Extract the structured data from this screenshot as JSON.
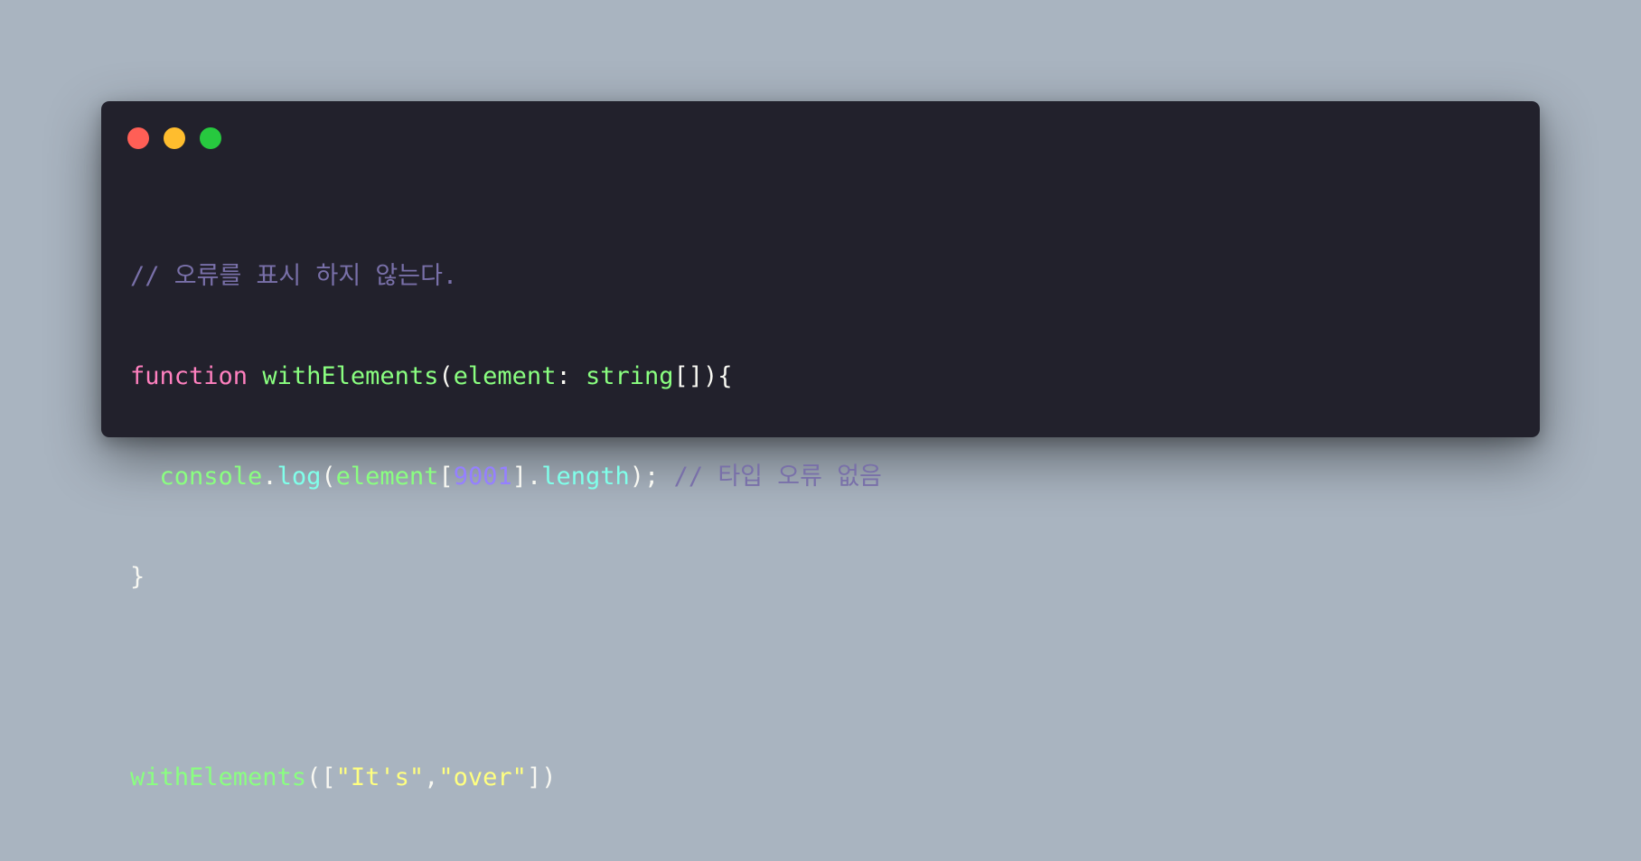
{
  "window": {
    "controls": {
      "close_color": "#ff5f56",
      "minimize_color": "#ffbd2e",
      "maximize_color": "#27c93f"
    }
  },
  "code": {
    "line1": {
      "comment": "// 오류를 표시 하지 않는다."
    },
    "line2": {
      "keyword": "function",
      "fn_name": "withElements",
      "open_paren": "(",
      "param": "element",
      "colon": ":",
      "type": "string",
      "type_suffix": "[]",
      "close": "){"
    },
    "line3": {
      "indent": "  ",
      "object": "console",
      "dot1": ".",
      "method": "log",
      "open_paren": "(",
      "ident": "element",
      "open_bracket": "[",
      "number": "9001",
      "close_bracket": "]",
      "dot2": ".",
      "prop": "length",
      "end": ");",
      "comment": "// 타입 오류 없음"
    },
    "line4": {
      "close_brace": "}"
    },
    "line6": {
      "fn_name": "withElements",
      "open": "([",
      "str1": "\"It's\"",
      "comma": ",",
      "str2": "\"over\"",
      "close": "])"
    }
  },
  "colors": {
    "background": "#a9b4c0",
    "editor_bg": "#22212c",
    "comment": "#7970a9",
    "keyword": "#ff80bf",
    "function": "#8aff80",
    "property": "#80ffea",
    "number": "#9580ff",
    "string": "#ffff80",
    "text": "#f8f8f2"
  }
}
